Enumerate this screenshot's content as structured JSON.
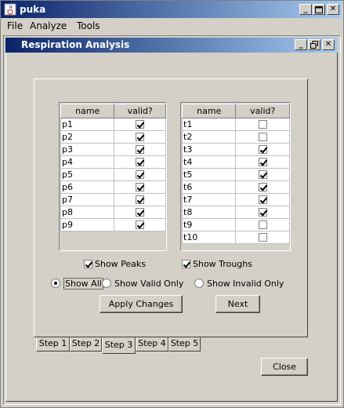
{
  "window": {
    "title": "puka",
    "controls": [
      "minimize",
      "maximize",
      "close"
    ]
  },
  "menu": {
    "items": [
      {
        "label": "File"
      },
      {
        "label": "Analyze"
      },
      {
        "label": "Tools"
      }
    ]
  },
  "internal_frame": {
    "title": "Respiration Analysis"
  },
  "peaks_table": {
    "headers": [
      "name",
      "valid?"
    ],
    "rows": [
      {
        "name": "p1",
        "valid": true
      },
      {
        "name": "p2",
        "valid": true
      },
      {
        "name": "p3",
        "valid": true
      },
      {
        "name": "p4",
        "valid": true
      },
      {
        "name": "p5",
        "valid": true
      },
      {
        "name": "p6",
        "valid": true
      },
      {
        "name": "p7",
        "valid": true
      },
      {
        "name": "p8",
        "valid": true
      },
      {
        "name": "p9",
        "valid": true
      }
    ]
  },
  "troughs_table": {
    "headers": [
      "name",
      "valid?"
    ],
    "rows": [
      {
        "name": "t1",
        "valid": false
      },
      {
        "name": "t2",
        "valid": false
      },
      {
        "name": "t3",
        "valid": true
      },
      {
        "name": "t4",
        "valid": true
      },
      {
        "name": "t5",
        "valid": true
      },
      {
        "name": "t6",
        "valid": true
      },
      {
        "name": "t7",
        "valid": true
      },
      {
        "name": "t8",
        "valid": true
      },
      {
        "name": "t9",
        "valid": false
      },
      {
        "name": "t10",
        "valid": false
      }
    ]
  },
  "options": {
    "show_peaks": {
      "label": "Show Peaks",
      "checked": true
    },
    "show_troughs": {
      "label": "Show Troughs",
      "checked": true
    },
    "filter": {
      "selected": "Show All",
      "choices": [
        "Show All",
        "Show Valid Only",
        "Show Invalid Only"
      ]
    }
  },
  "buttons": {
    "apply": "Apply Changes",
    "next": "Next",
    "close": "Close"
  },
  "tabs": {
    "items": [
      "Step 1",
      "Step 2",
      "Step 3",
      "Step 4",
      "Step 5"
    ],
    "selected": "Step 3"
  },
  "colors": {
    "title_gradient_start": "#0a246a",
    "title_gradient_end": "#a6caf0",
    "background": "#d4d0c8"
  }
}
